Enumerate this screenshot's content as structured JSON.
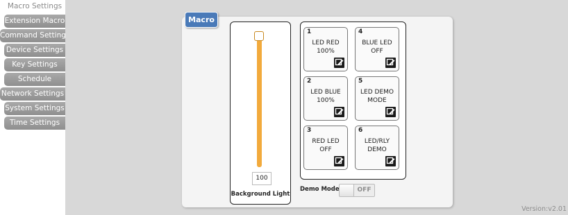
{
  "sidebar": {
    "items": [
      {
        "label": "Macro Settings"
      },
      {
        "label": "Extension Macro"
      },
      {
        "label": "Command Settings"
      },
      {
        "label": "Device Settings"
      },
      {
        "label": "Key Settings"
      },
      {
        "label": "Schedule"
      },
      {
        "label": "Network Settings"
      },
      {
        "label": "System Settings"
      },
      {
        "label": "Time Settings"
      }
    ]
  },
  "panel": {
    "tab_title": "Macro",
    "background_light": {
      "value": "100",
      "label": "Background Light",
      "level": 1.0
    },
    "macros": [
      {
        "num": "1",
        "label": "LED RED\n100%",
        "edit_icon": "edit-icon"
      },
      {
        "num": "4",
        "label": "BLUE LED\nOFF",
        "edit_icon": "edit-icon"
      },
      {
        "num": "2",
        "label": "LED BLUE\n100%",
        "edit_icon": "edit-icon"
      },
      {
        "num": "5",
        "label": "LED DEMO\nMODE",
        "edit_icon": "edit-icon"
      },
      {
        "num": "3",
        "label": "RED LED\nOFF",
        "edit_icon": "edit-icon"
      },
      {
        "num": "6",
        "label": "LED/RLY\nDEMO",
        "edit_icon": "edit-icon"
      }
    ],
    "demo_mode": {
      "label": "Demo Mode:",
      "state": "OFF"
    }
  },
  "footer": {
    "version": "Version:v2.01"
  },
  "colors": {
    "accent": "#4a7ab8",
    "slider": "#f2aa3c",
    "nav": "#999999"
  }
}
